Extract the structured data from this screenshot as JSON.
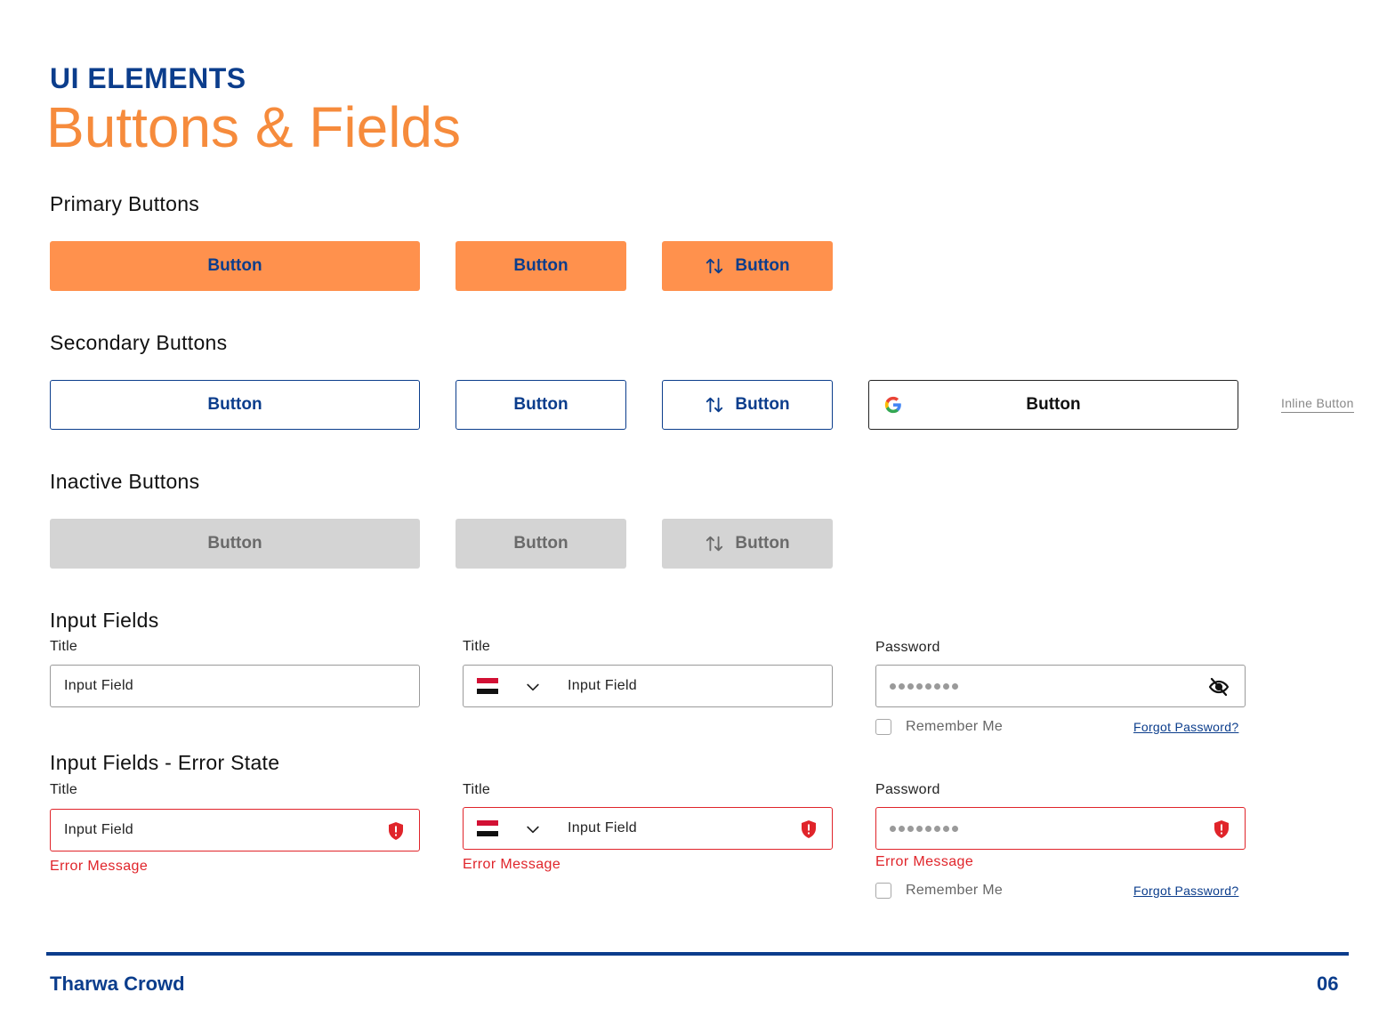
{
  "header": {
    "eyebrow": "UI ELEMENTS",
    "title": "Buttons & Fields"
  },
  "sections": {
    "primary": "Primary Buttons",
    "secondary": "Secondary Buttons",
    "inactive": "Inactive Buttons",
    "inputs": "Input Fields",
    "errors": "Input Fields - Error State"
  },
  "buttons": {
    "label": "Button",
    "inline_label": "Inline Button"
  },
  "inputs": {
    "title_label": "Title",
    "password_label": "Password",
    "field_value": "Input Field",
    "remember_me": "Remember Me",
    "forgot_password": "Forgot Password?",
    "error_message": "Error Message"
  },
  "colors": {
    "brand_blue": "#0b3d8c",
    "accent_orange": "#ff914d",
    "inactive_gray": "#d4d4d4",
    "error_red": "#e0242a"
  },
  "icons": [
    "sort-arrows-icon",
    "google-icon",
    "egypt-flag-icon",
    "chevron-down-icon",
    "eye-off-icon",
    "error-shield-icon"
  ],
  "footer": {
    "brand": "Tharwa Crowd",
    "page_number": "06"
  }
}
